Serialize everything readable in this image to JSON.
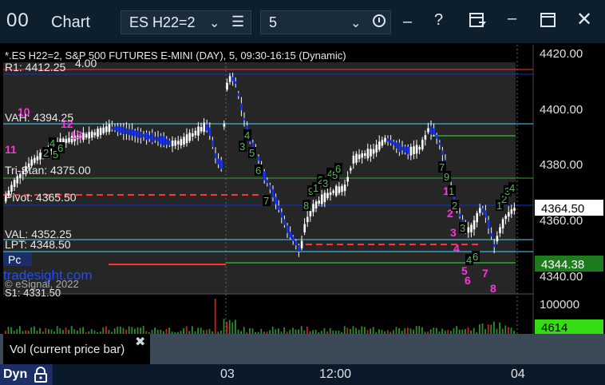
{
  "window": {
    "logo": "00",
    "title": "Chart",
    "symbol": "ES H22=2",
    "interval": "5"
  },
  "icons": {
    "chevron": "chevron-down-icon",
    "menu": "hamburger-menu-icon",
    "clock": "clock-icon",
    "minimize": "minimize-icon",
    "help": "help-icon",
    "template": "template-icon",
    "restore": "restore-icon",
    "maximize": "maximize-icon",
    "close": "close-icon",
    "lock": "lock-icon",
    "panel_close": "close-icon"
  },
  "chart": {
    "info_line": "*.ES H22=2, S&P 500 FUTURES E-MINI (DAY), 5, 09:30-16:15 (Dynamic)",
    "watermark": "tradesight.com",
    "copyright": "© eSignal, 2022",
    "price_axis": [
      "4420.00",
      "4400.00",
      "4380.00",
      "4360.00",
      "4340.00"
    ],
    "current_price": "4364.50",
    "level_price": "4344.38",
    "levels": [
      {
        "label": "R1: 4412.25",
        "color": "#ff3333"
      },
      {
        "label": "VAH: 4394.25",
        "color": "#4fd1ff"
      },
      {
        "label": "Tri-Stan: 4375.00",
        "color": "#3ad43a"
      },
      {
        "label": "Pivot: 4365.50",
        "color": "#ff3333"
      },
      {
        "label": "VAL: 4352.25",
        "color": "#4fd1ff"
      },
      {
        "label": "LPT: 4348.50",
        "color": "#4fd1ff"
      },
      {
        "label": "Pc",
        "color": "#3ad43a"
      },
      {
        "label": "S1: 4331.50",
        "color": "#ff3333"
      }
    ],
    "top_ticker_fragment": "4.00",
    "counts_magenta": [
      "10",
      "11",
      "12",
      "13",
      "1",
      "2",
      "3",
      "4",
      "5",
      "6",
      "7",
      "8"
    ],
    "counts_green": [
      "2",
      "4",
      "5",
      "6",
      "3",
      "4",
      "5",
      "6",
      "7",
      "8",
      "9",
      "1",
      "2",
      "3",
      "4",
      "5",
      "6",
      "7",
      "9",
      "1",
      "2",
      "3",
      "4",
      "6",
      "1",
      "2",
      "3",
      "4"
    ],
    "volume_axis": "100000",
    "volume_value": "4614",
    "volume_panel": "Vol (current price bar)",
    "x_labels": [
      "03",
      "12:00",
      "04"
    ],
    "mode": "Dyn"
  },
  "colors": {
    "bg": "#000000",
    "titlebar": "#0d1f2d",
    "up": "#ffffff",
    "down": "#1133ff",
    "volume": "#2e8b2e",
    "magenta": "#ff33dd",
    "green_label": "#40c840",
    "price_tag": "#ffffff",
    "level_tag": "#1e7b1e",
    "volume_tag": "#33dd11"
  }
}
